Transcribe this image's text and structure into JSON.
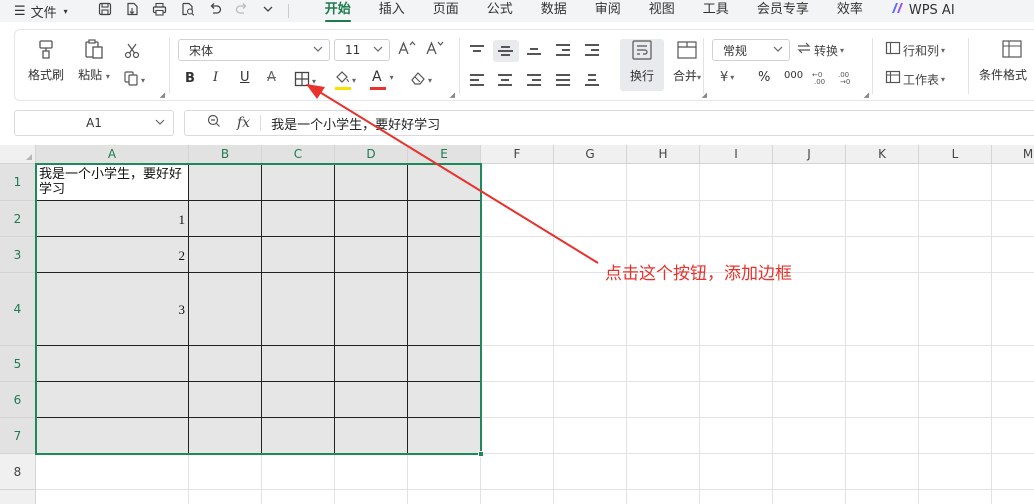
{
  "menubar": {
    "menu_icon": "hamburger-icon",
    "file_label": "文件",
    "quick_icons": [
      "save-icon",
      "export-pdf-icon",
      "print-icon",
      "print-preview-icon",
      "undo-icon",
      "redo-icon",
      "more-icon"
    ],
    "tabs": [
      {
        "label": "开始",
        "active": true
      },
      {
        "label": "插入"
      },
      {
        "label": "页面"
      },
      {
        "label": "公式"
      },
      {
        "label": "数据"
      },
      {
        "label": "审阅"
      },
      {
        "label": "视图"
      },
      {
        "label": "工具"
      },
      {
        "label": "会员专享"
      },
      {
        "label": "效率"
      },
      {
        "label": "WPS AI"
      }
    ]
  },
  "ribbon": {
    "format_painter": "格式刷",
    "paste": "粘贴",
    "font_name": "宋体",
    "font_size": "11",
    "bold": "B",
    "italic": "I",
    "underline": "U",
    "strike": "A",
    "font_color_glyph": "A",
    "wrap_label": "换行",
    "merge_label": "合并",
    "number_format": "常规",
    "convert_label": "转换",
    "currency_symbol": "¥",
    "percent_symbol": "%",
    "thousands_symbol": "000",
    "rows_cols_label": "行和列",
    "worksheet_label": "工作表",
    "cond_format_label": "条件格式",
    "colors": {
      "highlight": "#f5e300",
      "font": "#e8322b",
      "accent": "#1e7b4f"
    }
  },
  "formula_bar": {
    "name_box": "A1",
    "fx": "fx",
    "content": "我是一个小学生，要好好学习"
  },
  "sheet": {
    "columns": [
      "A",
      "B",
      "C",
      "D",
      "E",
      "F",
      "G",
      "H",
      "I",
      "J",
      "K",
      "L",
      "M"
    ],
    "rows": [
      "1",
      "2",
      "3",
      "4",
      "5",
      "6",
      "7",
      "8"
    ],
    "cells": {
      "A1": "我是一个小学生，要好好学习",
      "A2": "1",
      "A3": "2",
      "A4": "3"
    }
  },
  "annotation": {
    "text": "点击这个按钮，添加边框",
    "color": "#e8322b"
  }
}
